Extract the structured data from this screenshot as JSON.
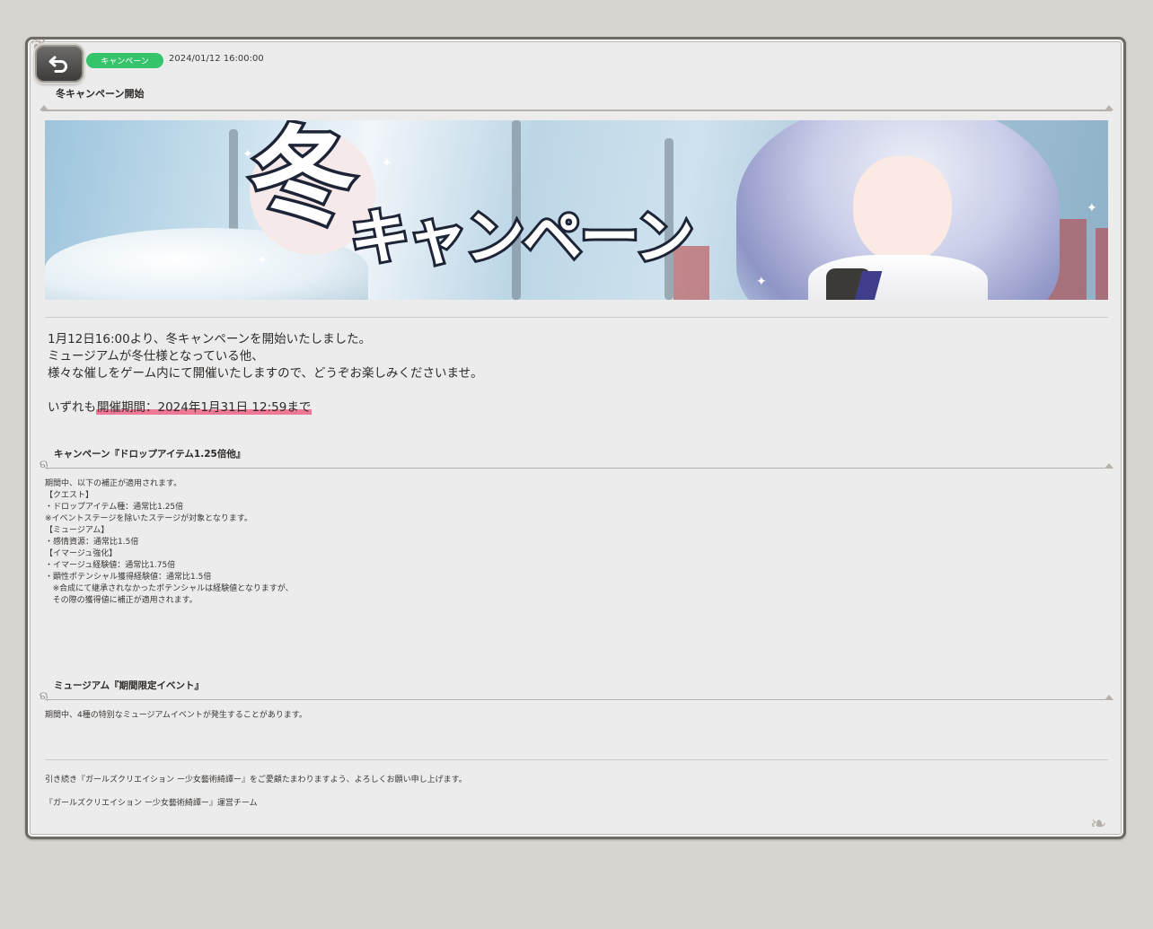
{
  "header": {
    "back_button": "back",
    "category_tag": "キャンペーン",
    "datetime": "2024/01/12 16:00:00",
    "title": "冬キャンペーン開始"
  },
  "banner": {
    "kanji": "冬",
    "kana": "キャンペーン"
  },
  "intro": {
    "line1": "1月12日16:00より、冬キャンペーンを開始いたしました。",
    "line2": "ミュージアムが冬仕様となっている他、",
    "line3": "様々な催しをゲーム内にて開催いたしますので、どうぞお楽しみくださいませ。",
    "period_prefix": "いずれも",
    "period_highlight": "開催期間：2024年1月31日 12:59まで"
  },
  "section1": {
    "title": "キャンペーン『ドロップアイテム1.25倍他』",
    "lines": [
      "期間中、以下の補正が適用されます。",
      "",
      "【クエスト】",
      "・ドロップアイテム種：通常比1.25倍",
      "",
      "※イベントステージを除いたステージが対象となります。",
      "",
      "【ミュージアム】",
      "・感情資源：通常比1.5倍",
      "",
      "【イマージュ強化】",
      "・イマージュ経験値：通常比1.75倍",
      "・顕性ポテンシャル獲得経験値：通常比1.5倍",
      "   ※合成にて継承されなかったポテンシャルは経験値となりますが、",
      "   その際の獲得値に補正が適用されます。"
    ]
  },
  "section2": {
    "title": "ミュージアム『期間限定イベント』",
    "lines": [
      "期間中、4種の特別なミュージアムイベントが発生することがあります。"
    ]
  },
  "footer": {
    "line1": "引き続き『ガールズクリエイション ー少女藝術綺譚ー』をご愛顧たまわりますよう、よろしくお願い申し上げます。",
    "line2": "『ガールズクリエイション ー少女藝術綺譚ー』運営チーム"
  },
  "colors": {
    "tag_green": "#35c46b",
    "highlight_pink": "#f07897",
    "panel_bg": "#ececec"
  }
}
